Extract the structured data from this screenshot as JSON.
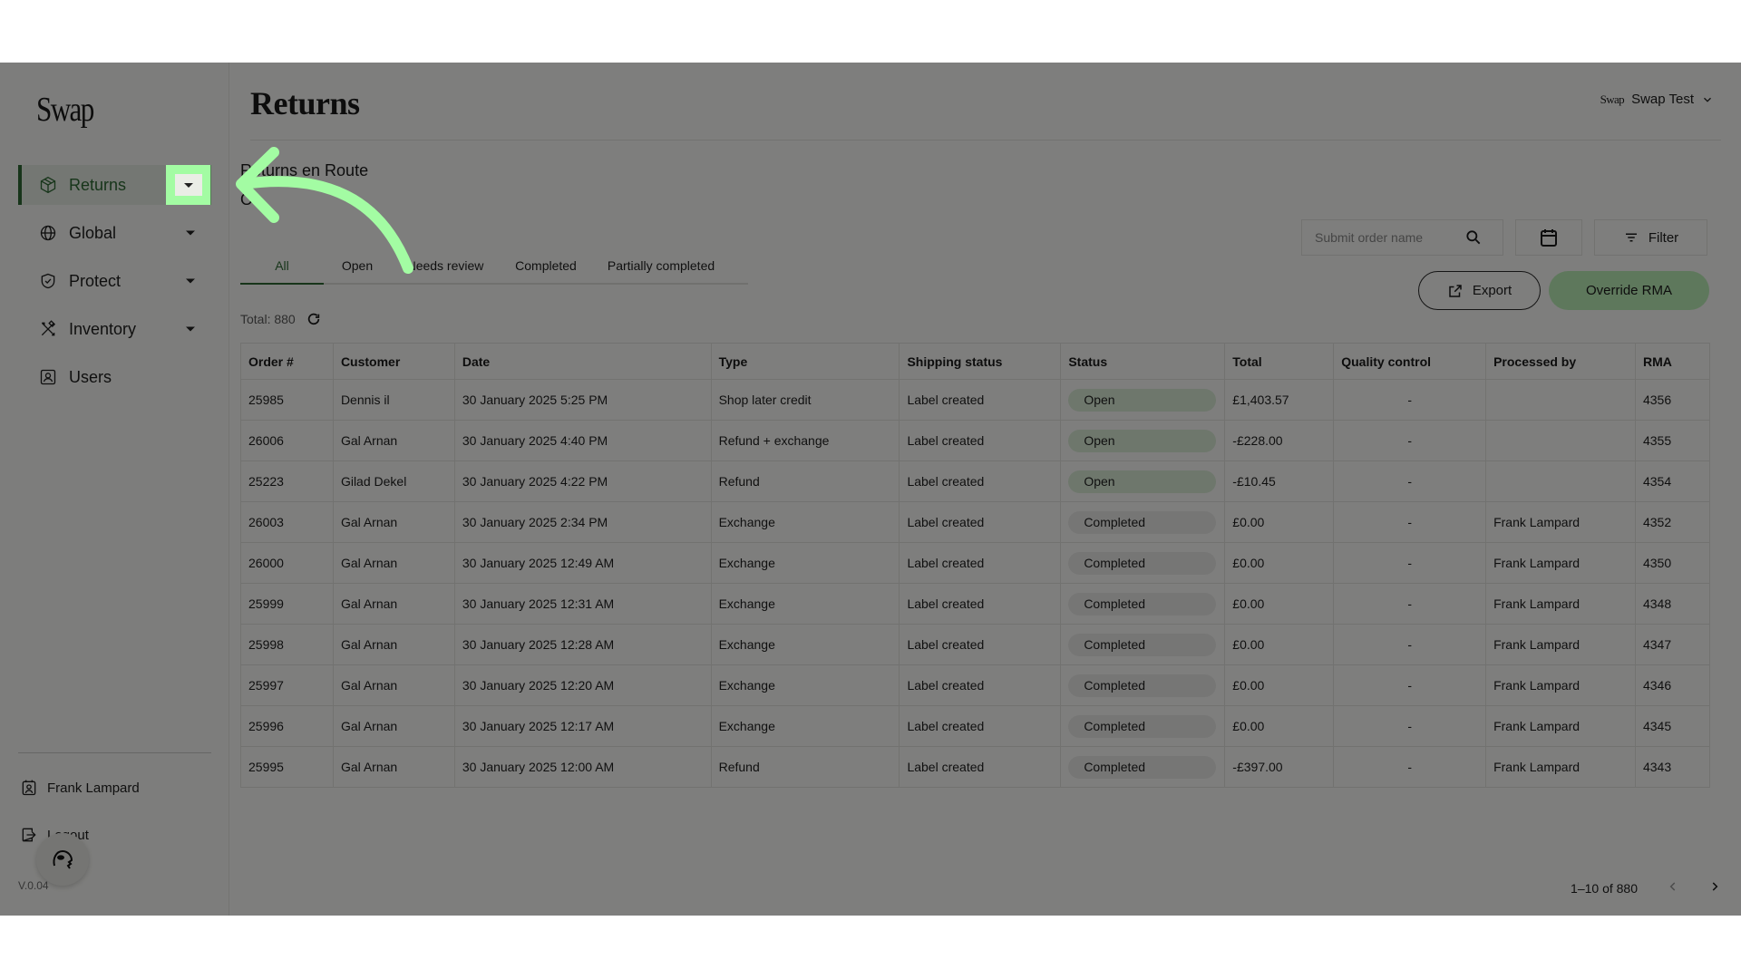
{
  "sidebar": {
    "logo": "Swap",
    "items": [
      {
        "label": "Returns",
        "icon": "package-icon",
        "active": true,
        "has_caret": true
      },
      {
        "label": "Global",
        "icon": "globe-icon",
        "active": false,
        "has_caret": true
      },
      {
        "label": "Protect",
        "icon": "shield-check-icon",
        "active": false,
        "has_caret": true
      },
      {
        "label": "Inventory",
        "icon": "tools-icon",
        "active": false,
        "has_caret": true
      },
      {
        "label": "Users",
        "icon": "user-card-icon",
        "active": false,
        "has_caret": false
      }
    ],
    "user_name": "Frank Lampard",
    "logout_label": "Logout",
    "version": "V.0.04"
  },
  "header": {
    "title": "Returns",
    "account_logo": "Swap",
    "account_name": "Swap Test"
  },
  "section": {
    "title": "Returns en Route",
    "second_line": "O"
  },
  "tabs": [
    {
      "label": "All",
      "active": true
    },
    {
      "label": "Open",
      "active": false
    },
    {
      "label": "Needs review",
      "active": false
    },
    {
      "label": "Completed",
      "active": false
    },
    {
      "label": "Partially completed",
      "active": false
    }
  ],
  "toolbar": {
    "search_placeholder": "Submit order name",
    "filter_label": "Filter",
    "export_label": "Export",
    "override_label": "Override RMA"
  },
  "total_label": "Total: 880",
  "table": {
    "columns": [
      "Order #",
      "Customer",
      "Date",
      "Type",
      "Shipping status",
      "Status",
      "Total",
      "Quality control",
      "Processed by",
      "RMA"
    ],
    "rows": [
      {
        "order": "25985",
        "customer": "Dennis il",
        "date": "30 January 2025 5:25 PM",
        "type": "Shop later credit",
        "shipping": "Label created",
        "status": "Open",
        "total": "£1,403.57",
        "qc": "-",
        "processed_by": "",
        "rma": "4356"
      },
      {
        "order": "26006",
        "customer": "Gal Arnan",
        "date": "30 January 2025 4:40 PM",
        "type": "Refund + exchange",
        "shipping": "Label created",
        "status": "Open",
        "total": "-£228.00",
        "qc": "-",
        "processed_by": "",
        "rma": "4355"
      },
      {
        "order": "25223",
        "customer": "Gilad Dekel",
        "date": "30 January 2025 4:22 PM",
        "type": "Refund",
        "shipping": "Label created",
        "status": "Open",
        "total": "-£10.45",
        "qc": "-",
        "processed_by": "",
        "rma": "4354"
      },
      {
        "order": "26003",
        "customer": "Gal Arnan",
        "date": "30 January 2025 2:34 PM",
        "type": "Exchange",
        "shipping": "Label created",
        "status": "Completed",
        "total": "£0.00",
        "qc": "-",
        "processed_by": "Frank Lampard",
        "rma": "4352"
      },
      {
        "order": "26000",
        "customer": "Gal Arnan",
        "date": "30 January 2025 12:49 AM",
        "type": "Exchange",
        "shipping": "Label created",
        "status": "Completed",
        "total": "£0.00",
        "qc": "-",
        "processed_by": "Frank Lampard",
        "rma": "4350"
      },
      {
        "order": "25999",
        "customer": "Gal Arnan",
        "date": "30 January 2025 12:31 AM",
        "type": "Exchange",
        "shipping": "Label created",
        "status": "Completed",
        "total": "£0.00",
        "qc": "-",
        "processed_by": "Frank Lampard",
        "rma": "4348"
      },
      {
        "order": "25998",
        "customer": "Gal Arnan",
        "date": "30 January 2025 12:28 AM",
        "type": "Exchange",
        "shipping": "Label created",
        "status": "Completed",
        "total": "£0.00",
        "qc": "-",
        "processed_by": "Frank Lampard",
        "rma": "4347"
      },
      {
        "order": "25997",
        "customer": "Gal Arnan",
        "date": "30 January 2025 12:20 AM",
        "type": "Exchange",
        "shipping": "Label created",
        "status": "Completed",
        "total": "£0.00",
        "qc": "-",
        "processed_by": "Frank Lampard",
        "rma": "4346"
      },
      {
        "order": "25996",
        "customer": "Gal Arnan",
        "date": "30 January 2025 12:17 AM",
        "type": "Exchange",
        "shipping": "Label created",
        "status": "Completed",
        "total": "£0.00",
        "qc": "-",
        "processed_by": "Frank Lampard",
        "rma": "4345"
      },
      {
        "order": "25995",
        "customer": "Gal Arnan",
        "date": "30 January 2025 12:00 AM",
        "type": "Refund",
        "shipping": "Label created",
        "status": "Completed",
        "total": "-£397.00",
        "qc": "-",
        "processed_by": "Frank Lampard",
        "rma": "4343"
      }
    ]
  },
  "pagination": {
    "range_label": "1–10 of 880",
    "prev_enabled": false,
    "next_enabled": true
  },
  "colors": {
    "accent_green": "#2f6b34",
    "override_button": "#bdf0b9",
    "open_pill": "#dcefd9",
    "completed_pill": "#ececea",
    "highlight": "#a3fca3",
    "overlay": "rgba(0,0,0,0.5)"
  }
}
